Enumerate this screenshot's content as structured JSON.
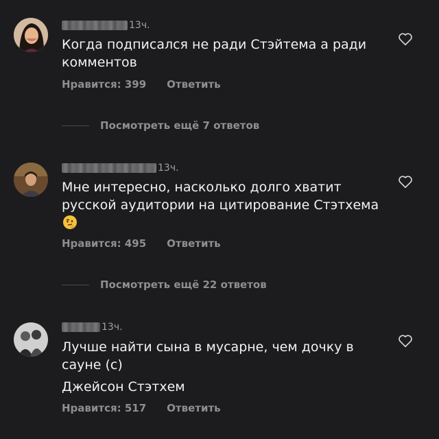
{
  "comments": [
    {
      "time": "13ч.",
      "text": "Когда подписался не ради Стэйтема а ради комментов",
      "likes": "Нравится: 399",
      "reply": "Ответить",
      "view_replies": "Посмотреть ещё 7 ответов",
      "avatar_icon": "user-photo-avatar"
    },
    {
      "time": "13ч.",
      "text": "Мне интересно, насколько долго хватит русской аудитории на цитирование Стэтхема",
      "emoji": "thinking-face-emoji",
      "likes": "Нравится: 495",
      "reply": "Ответить",
      "view_replies": "Посмотреть ещё 22 ответов",
      "avatar_icon": "user-photo-avatar"
    },
    {
      "time": "13ч.",
      "text": "Лучше найти сына в мусарне, чем дочку в сауне (с)",
      "text2": "Джейсон Стэтхем",
      "likes": "Нравится: 517",
      "reply": "Ответить",
      "avatar_icon": "user-photo-avatar"
    }
  ],
  "colors": {
    "background": "#1c1c1e",
    "text": "#f2f2f2",
    "secondary": "#8e8e93"
  }
}
